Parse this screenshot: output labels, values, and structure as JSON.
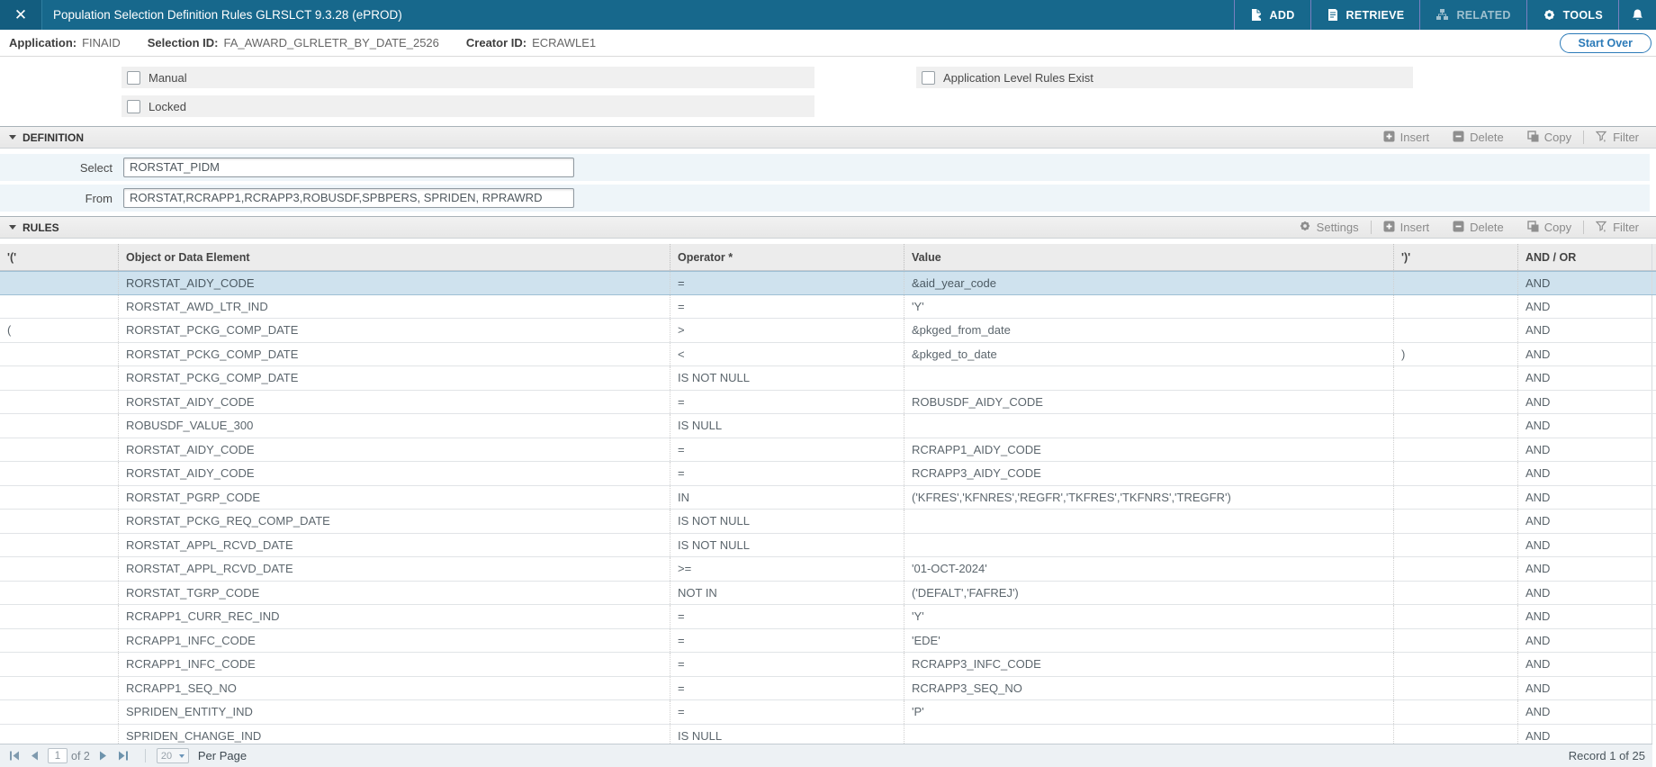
{
  "titlebar": {
    "close_glyph": "✕",
    "title": "Population Selection Definition Rules GLRSLCT 9.3.28 (ePROD)",
    "actions": [
      {
        "label": "ADD",
        "icon": "add-document-icon",
        "enabled": true
      },
      {
        "label": "RETRIEVE",
        "icon": "retrieve-document-icon",
        "enabled": true
      },
      {
        "label": "RELATED",
        "icon": "related-sitemap-icon",
        "enabled": false
      },
      {
        "label": "TOOLS",
        "icon": "tools-gear-icon",
        "enabled": true
      }
    ]
  },
  "key_header": {
    "fields": [
      {
        "label": "Application:",
        "value": "FINAID"
      },
      {
        "label": "Selection ID:",
        "value": "FA_AWARD_GLRLETR_BY_DATE_2526"
      },
      {
        "label": "Creator ID:",
        "value": "ECRAWLE1"
      }
    ],
    "start_over_label": "Start Over"
  },
  "options": {
    "checkboxes": [
      {
        "label": "Manual",
        "checked": false
      },
      {
        "label": "Locked",
        "checked": false
      },
      {
        "label": "Application Level Rules Exist",
        "checked": false
      }
    ]
  },
  "toolbar_labels": {
    "settings": "Settings",
    "insert": "Insert",
    "delete": "Delete",
    "copy": "Copy",
    "filter": "Filter"
  },
  "definition": {
    "title": "DEFINITION",
    "fields": [
      {
        "label": "Select",
        "value": "RORSTAT_PIDM"
      },
      {
        "label": "From",
        "value": "RORSTAT,RCRAPP1,RCRAPP3,ROBUSDF,SPBPERS, SPRIDEN, RPRAWRD"
      }
    ]
  },
  "rules": {
    "title": "RULES",
    "columns": [
      "'('",
      "Object or Data Element",
      "Operator *",
      "Value",
      "')'",
      "AND / OR"
    ],
    "rows": [
      {
        "open": "",
        "object": "RORSTAT_AIDY_CODE",
        "operator": "=",
        "value": "&aid_year_code",
        "close": "",
        "andor": "AND",
        "selected": true
      },
      {
        "open": "",
        "object": "RORSTAT_AWD_LTR_IND",
        "operator": "=",
        "value": "'Y'",
        "close": "",
        "andor": "AND",
        "selected": false
      },
      {
        "open": "(",
        "object": "RORSTAT_PCKG_COMP_DATE",
        "operator": ">",
        "value": "&pkged_from_date",
        "close": "",
        "andor": "AND",
        "selected": false
      },
      {
        "open": "",
        "object": "RORSTAT_PCKG_COMP_DATE",
        "operator": "<",
        "value": "&pkged_to_date",
        "close": ")",
        "andor": "AND",
        "selected": false
      },
      {
        "open": "",
        "object": "RORSTAT_PCKG_COMP_DATE",
        "operator": "IS NOT NULL",
        "value": "",
        "close": "",
        "andor": "AND",
        "selected": false
      },
      {
        "open": "",
        "object": "RORSTAT_AIDY_CODE",
        "operator": "=",
        "value": "ROBUSDF_AIDY_CODE",
        "close": "",
        "andor": "AND",
        "selected": false
      },
      {
        "open": "",
        "object": "ROBUSDF_VALUE_300",
        "operator": "IS NULL",
        "value": "",
        "close": "",
        "andor": "AND",
        "selected": false
      },
      {
        "open": "",
        "object": "RORSTAT_AIDY_CODE",
        "operator": "=",
        "value": "RCRAPP1_AIDY_CODE",
        "close": "",
        "andor": "AND",
        "selected": false
      },
      {
        "open": "",
        "object": "RORSTAT_AIDY_CODE",
        "operator": "=",
        "value": "RCRAPP3_AIDY_CODE",
        "close": "",
        "andor": "AND",
        "selected": false
      },
      {
        "open": "",
        "object": "RORSTAT_PGRP_CODE",
        "operator": "IN",
        "value": "('KFRES','KFNRES','REGFR','TKFRES','TKFNRS','TREGFR')",
        "close": "",
        "andor": "AND",
        "selected": false
      },
      {
        "open": "",
        "object": "RORSTAT_PCKG_REQ_COMP_DATE",
        "operator": "IS NOT NULL",
        "value": "",
        "close": "",
        "andor": "AND",
        "selected": false
      },
      {
        "open": "",
        "object": "RORSTAT_APPL_RCVD_DATE",
        "operator": "IS NOT NULL",
        "value": "",
        "close": "",
        "andor": "AND",
        "selected": false
      },
      {
        "open": "",
        "object": "RORSTAT_APPL_RCVD_DATE",
        "operator": ">=",
        "value": "'01-OCT-2024'",
        "close": "",
        "andor": "AND",
        "selected": false
      },
      {
        "open": "",
        "object": "RORSTAT_TGRP_CODE",
        "operator": "NOT IN",
        "value": "('DEFALT','FAFREJ')",
        "close": "",
        "andor": "AND",
        "selected": false
      },
      {
        "open": "",
        "object": "RCRAPP1_CURR_REC_IND",
        "operator": "=",
        "value": "'Y'",
        "close": "",
        "andor": "AND",
        "selected": false
      },
      {
        "open": "",
        "object": "RCRAPP1_INFC_CODE",
        "operator": "=",
        "value": "'EDE'",
        "close": "",
        "andor": "AND",
        "selected": false
      },
      {
        "open": "",
        "object": "RCRAPP1_INFC_CODE",
        "operator": "=",
        "value": "RCRAPP3_INFC_CODE",
        "close": "",
        "andor": "AND",
        "selected": false
      },
      {
        "open": "",
        "object": "RCRAPP1_SEQ_NO",
        "operator": "=",
        "value": "RCRAPP3_SEQ_NO",
        "close": "",
        "andor": "AND",
        "selected": false
      },
      {
        "open": "",
        "object": "SPRIDEN_ENTITY_IND",
        "operator": "=",
        "value": "'P'",
        "close": "",
        "andor": "AND",
        "selected": false
      },
      {
        "open": "",
        "object": "SPRIDEN_CHANGE_IND",
        "operator": "IS NULL",
        "value": "",
        "close": "",
        "andor": "AND",
        "selected": false
      }
    ]
  },
  "pagination": {
    "page_value": "1",
    "of_label": "of 2",
    "per_page_value": "20",
    "per_page_label": "Per Page",
    "record_text": "Record 1 of 25"
  },
  "icons": {
    "close-icon": "✕",
    "add-document-icon": "document-with-plus",
    "retrieve-document-icon": "document-with-lines",
    "related-sitemap-icon": "org-chart-boxes",
    "tools-gear-icon": "gear",
    "bell-icon": "notification-bell",
    "section-collapse-icon": "triangle-down",
    "insert-icon": "square-plus",
    "delete-icon": "square-minus",
    "copy-icon": "overlapping-squares",
    "filter-icon": "funnel",
    "settings-icon": "gear",
    "pager-icons": "first/prev/next/last triangles"
  },
  "colors": {
    "topbar_bg": "#17688c",
    "accent_blue": "#2b7ab8",
    "selected_row_bg": "#cfe2ee",
    "strip_gray": "#f0f0f0",
    "definition_row_bg": "#eef5f9",
    "toolbar_separator_purple": "#7a7fc0"
  }
}
